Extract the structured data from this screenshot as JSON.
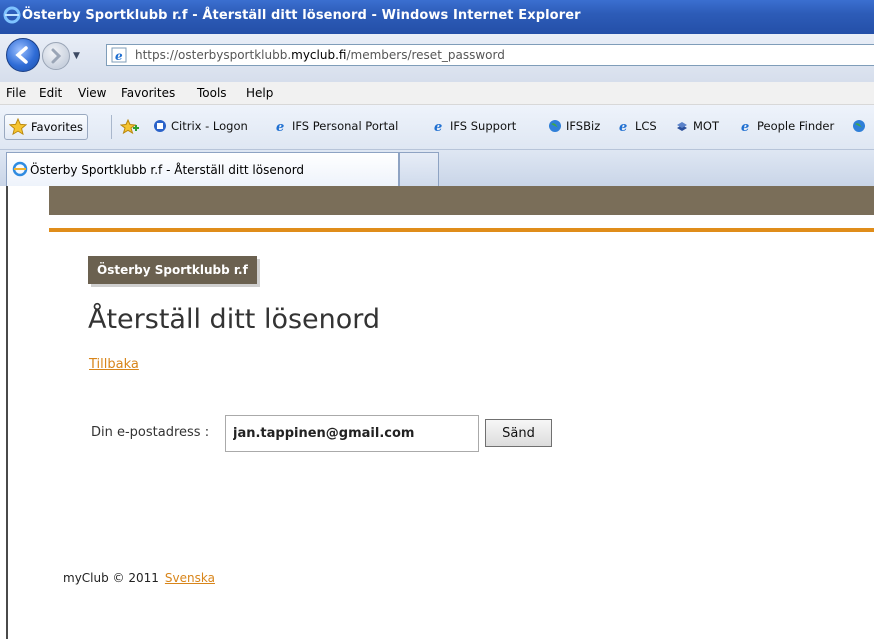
{
  "window": {
    "title": "Österby Sportklubb r.f - Återställ ditt lösenord - Windows Internet Explorer"
  },
  "address": {
    "url_prefix": "https://osterbysportklubb.",
    "url_domain": "myclub.fi",
    "url_path": "/members/reset_password"
  },
  "menu": [
    "File",
    "Edit",
    "View",
    "Favorites",
    "Tools",
    "Help"
  ],
  "favorites": {
    "label": "Favorites",
    "links": [
      "Citrix - Logon",
      "IFS Personal Portal",
      "IFS Support",
      "IFSBiz",
      "LCS",
      "MOT",
      "People Finder"
    ]
  },
  "tab": {
    "label": "Österby Sportklubb r.f - Återställ ditt lösenord"
  },
  "page": {
    "club_name": "Österby Sportklubb r.f",
    "title": "Återställ ditt lösenord",
    "back_link": "Tillbaka",
    "email_label": "Din e-postadress :",
    "email_value": "jan.tappinen@gmail.com",
    "send_label": "Sänd",
    "footer_text": "myClub © 2011",
    "footer_lang": "Svenska"
  },
  "colors": {
    "brown_bar": "#7a6e59",
    "orange_line": "#e08d1a",
    "link": "#d8851a"
  }
}
